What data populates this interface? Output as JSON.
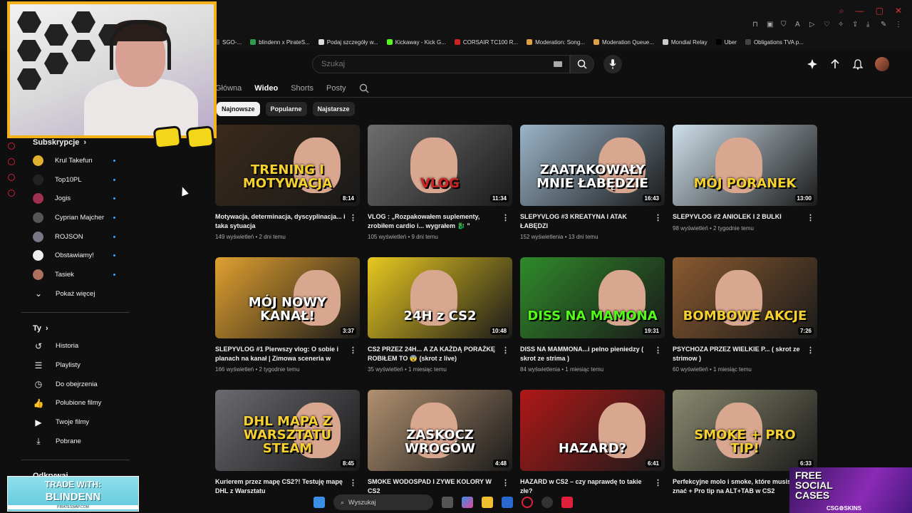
{
  "browser": {
    "bookmarks": [
      {
        "label": "SGO-...",
        "color": "#444444"
      },
      {
        "label": "blindenn x PirateS...",
        "color": "#2e9b4e"
      },
      {
        "label": "Podaj szczegóły w...",
        "color": "#dddddd"
      },
      {
        "label": "Kickaway - Kick G...",
        "color": "#53fc18"
      },
      {
        "label": "CORSAIR TC100 R...",
        "color": "#cc2222"
      },
      {
        "label": "Moderation: Song...",
        "color": "#e0a040"
      },
      {
        "label": "Moderation Queue...",
        "color": "#e0a040"
      },
      {
        "label": "Mondial Relay",
        "color": "#cccccc"
      },
      {
        "label": "Uber",
        "color": "#000000"
      },
      {
        "label": "Obligations TVA p...",
        "color": "#444444"
      }
    ]
  },
  "header": {
    "search_placeholder": "Szukaj"
  },
  "tabs": [
    {
      "label": "Główna",
      "active": false
    },
    {
      "label": "Wideo",
      "active": true
    },
    {
      "label": "Shorts",
      "active": false
    },
    {
      "label": "Posty",
      "active": false
    }
  ],
  "chips": [
    {
      "label": "Najnowsze",
      "active": true
    },
    {
      "label": "Popularne",
      "active": false
    },
    {
      "label": "Najstarsze",
      "active": false
    }
  ],
  "sidebar": {
    "subscriptions_title": "Subskrypcje",
    "channels": [
      {
        "label": "Krul Takefun",
        "color": "#e0b030"
      },
      {
        "label": "Top10PL",
        "color": "#222222"
      },
      {
        "label": "Jogis",
        "color": "#a03050"
      },
      {
        "label": "Cyprian Majcher",
        "color": "#555555"
      },
      {
        "label": "ROJSON",
        "color": "#777788"
      },
      {
        "label": "Obstawiamy!",
        "color": "#eeeeee"
      },
      {
        "label": "Tasiek",
        "color": "#b07060"
      }
    ],
    "show_more": "Pokaż więcej",
    "you_title": "Ty",
    "you_items": [
      {
        "label": "Historia",
        "icon": "history-icon"
      },
      {
        "label": "Playlisty",
        "icon": "playlist-icon"
      },
      {
        "label": "Do obejrzenia",
        "icon": "clock-icon"
      },
      {
        "label": "Polubione filmy",
        "icon": "thumb-up-icon"
      },
      {
        "label": "Twoje filmy",
        "icon": "video-icon"
      },
      {
        "label": "Pobrane",
        "icon": "download-icon"
      }
    ],
    "explore_title": "Odkrywaj"
  },
  "videos": [
    {
      "title": "Motywacja, determinacja, dyscyplinacja... i taka sytuacja",
      "meta": "149 wyświetleń • 2 dni temu",
      "duration": "8:14",
      "thumb_text": "TRENING I MOTYWACJA",
      "bg": "#3a2a1a",
      "accent": "#f5d030"
    },
    {
      "title": "VLOG : „Rozpakowałem suplementy, zrobiłem cardio i... wygrałem 🐉 ”",
      "meta": "105 wyświetleń • 9 dni temu",
      "duration": "11:34",
      "thumb_text": "VLOG",
      "bg": "#6e6e6e",
      "accent": "#d02020"
    },
    {
      "title": "SLEPYVLOG #3 KREATYNA I ATAK ŁABĘDZI",
      "meta": "152 wyświetlenia • 13 dni temu",
      "duration": "16:43",
      "thumb_text": "ZAATAKOWAŁY MNIE ŁABĘDZIE",
      "bg": "#9ab4c8",
      "accent": "#ffffff"
    },
    {
      "title": "SLEPYVLOG #2 ANIOLEK I 2 BULKI",
      "meta": "98 wyświetleń • 2 tygodnie temu",
      "duration": "13:00",
      "thumb_text": "MÓJ PORANEK",
      "bg": "#cfe0ea",
      "accent": "#f5d030"
    },
    {
      "title": "SLEPYVLOG #1 Pierwszy vlog: O sobie i planach na kanał | Zimowa sceneria w park...",
      "meta": "166 wyświetleń • 2 tygodnie temu",
      "duration": "3:37",
      "thumb_text": "MÓJ NOWY KANAŁ!",
      "bg": "#e0a030",
      "accent": "#ffffff"
    },
    {
      "title": "CS2 PRZEZ 24H... A ZA KAŻDĄ PORAŻKĘ ROBIŁEM TO 😨 (skrot z live)",
      "meta": "35 wyświetleń • 1 miesiąc temu",
      "duration": "10:48",
      "thumb_text": "24H z CS2",
      "bg": "#e8c820",
      "accent": "#ffffff"
    },
    {
      "title": "DISS NA MAMMONA...i pelno pieniedzy ( skrot ze strima )",
      "meta": "84 wyświetlenia • 1 miesiąc temu",
      "duration": "19:31",
      "thumb_text": "DISS NA MAMONA",
      "bg": "#2f8a2a",
      "accent": "#53fc18"
    },
    {
      "title": "PSYCHOZA PRZEZ WIELKIE P... ( skrot ze strimow )",
      "meta": "60 wyświetleń • 1 miesiąc temu",
      "duration": "7:26",
      "thumb_text": "BOMBOWE AKCJE",
      "bg": "#8a5a30",
      "accent": "#f5d030"
    },
    {
      "title": "Kurierem przez mapę CS2?! Testuję mapę DHL z Warsztatu",
      "meta": "",
      "duration": "8:45",
      "thumb_text": "DHL MAPA Z WARSZTATU STEAM",
      "bg": "#6a6a70",
      "accent": "#f5d030"
    },
    {
      "title": "SMOKE WODOSPAD I ZYWE KOLORY W CS2",
      "meta": "",
      "duration": "4:48",
      "thumb_text": "ZASKOCZ WROGÓW",
      "bg": "#b09070",
      "accent": "#ffffff"
    },
    {
      "title": "HAZARD w CS2 – czy naprawdę to takie złe?",
      "meta": "",
      "duration": "6:41",
      "thumb_text": "HAZARD?",
      "bg": "#b01818",
      "accent": "#ffffff"
    },
    {
      "title": "Perfekcyjne molo i smoke, które musisz znać + Pro tip na ALT+TAB w CS2",
      "meta": "",
      "duration": "6:33",
      "thumb_text": "SMOKE + PRO TIP!",
      "bg": "#8a8a70",
      "accent": "#f5d030"
    }
  ],
  "overlays": {
    "trade_line1": "TRADE WITH:",
    "trade_line2": "BLINDENN",
    "trade_line3": "PIRATESWAP.COM",
    "cases_line1": "FREE SOCIAL CASES",
    "cases_line2": "CSG⚙SKINS"
  },
  "taskbar": {
    "search_label": "Wyszukaj"
  }
}
